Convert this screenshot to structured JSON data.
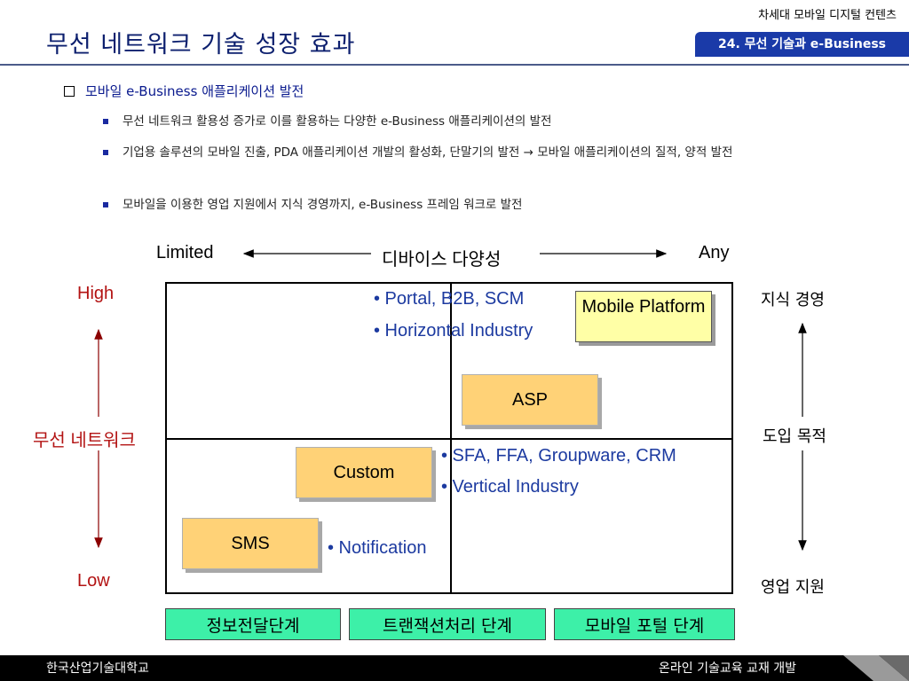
{
  "header": {
    "title": "무선 네트워크 기술 성장 효과",
    "course": "차세대 모바일 디지털 컨텐츠",
    "chapter": "24. 무선 기술과 e-Business"
  },
  "section": {
    "heading": "모바일 e-Business 애플리케이션 발전",
    "bullets": [
      "무선 네트워크 활용성 증가로 이를 활용하는 다양한 e-Business 애플리케이션의 발전",
      "기업용 솔루션의  모바일 진출, PDA 애플리케이션 개발의 활성화, 단말기의 발전 → 모바일 애플리케이션의 질적, 양적 발전",
      "모바일을 이용한 영업 지원에서 지식 경영까지, e-Business 프레임 워크로 발전"
    ]
  },
  "diagram": {
    "x_axis": {
      "left": "Limited",
      "center": "디바이스 다양성",
      "right": "Any"
    },
    "y_axis": {
      "top": "High",
      "center": "무선 네트워크",
      "bottom": "Low"
    },
    "right_axis": {
      "top": "지식 경영",
      "center": "도입 목적",
      "bottom": "영업 지원"
    },
    "boxes": {
      "mobile_platform": "Mobile Platform",
      "asp": "ASP",
      "custom": "Custom",
      "sms": "SMS"
    },
    "notes": {
      "top_1": "• Portal, B2B, SCM",
      "top_2": "• Horizontal Industry",
      "mid_1": "• SFA, FFA, Groupware, CRM",
      "mid_2": "• Vertical Industry",
      "low_1": "• Notification"
    },
    "stages": [
      "정보전달단계",
      "트랜잭션처리 단계",
      "모바일 포털 단계"
    ]
  },
  "footer": {
    "left": "한국산업기술대학교",
    "right": "온라인 기술교육 교재 개발"
  }
}
